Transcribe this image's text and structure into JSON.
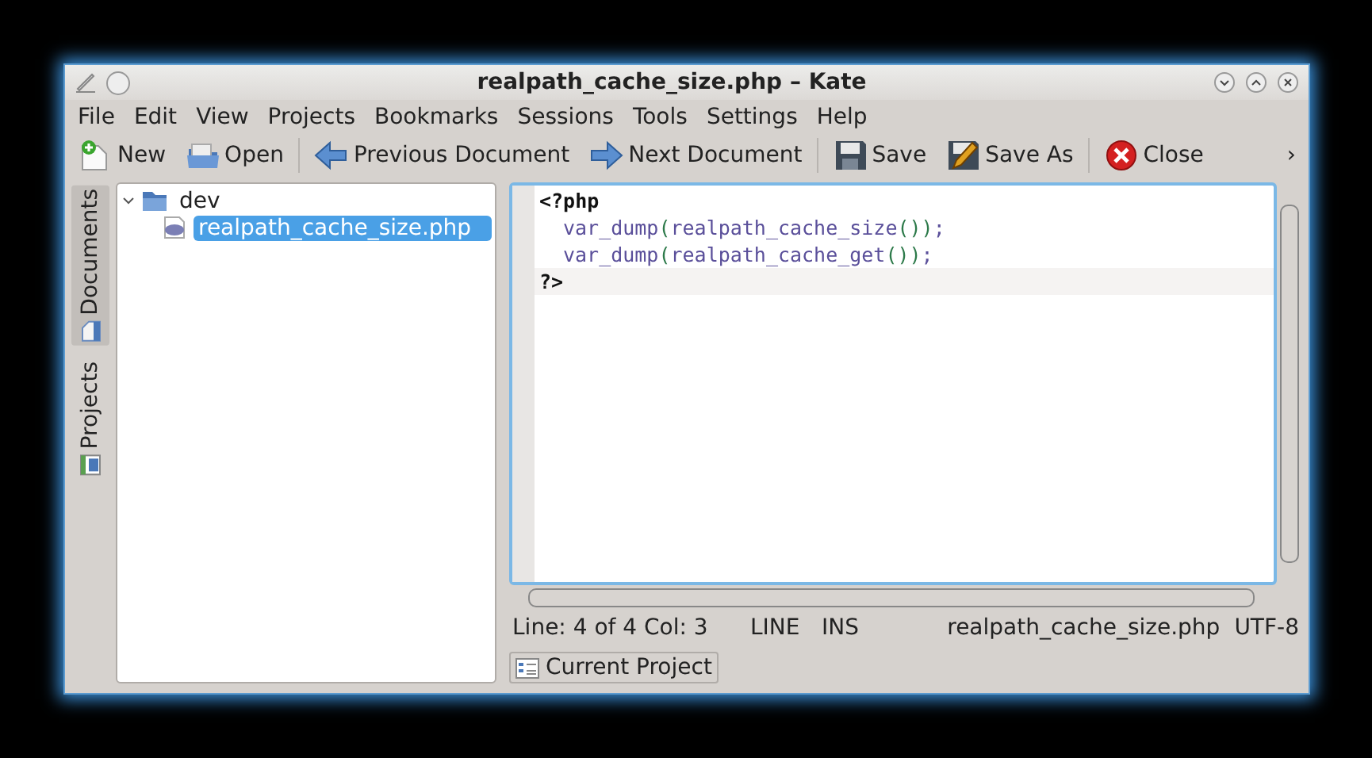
{
  "window": {
    "title": "realpath_cache_size.php – Kate"
  },
  "menu": [
    "File",
    "Edit",
    "View",
    "Projects",
    "Bookmarks",
    "Sessions",
    "Tools",
    "Settings",
    "Help"
  ],
  "toolbar": [
    {
      "kind": "new",
      "label": "New"
    },
    {
      "kind": "open",
      "label": "Open"
    },
    {
      "kind": "sep"
    },
    {
      "kind": "prev",
      "label": "Previous Document"
    },
    {
      "kind": "next",
      "label": "Next Document"
    },
    {
      "kind": "sep"
    },
    {
      "kind": "save",
      "label": "Save"
    },
    {
      "kind": "saveas",
      "label": "Save As"
    },
    {
      "kind": "sep"
    },
    {
      "kind": "close",
      "label": "Close"
    }
  ],
  "overflow": "›",
  "side_tabs": [
    {
      "label": "Documents",
      "selected": true
    },
    {
      "label": "Projects",
      "selected": false
    }
  ],
  "tree": [
    {
      "label": "dev",
      "expanded": true,
      "selected": false,
      "children": [
        {
          "label": "realpath_cache_size.php",
          "selected": true
        }
      ]
    }
  ],
  "editor": {
    "lines": [
      {
        "current": false,
        "indent": false,
        "tokens": [
          {
            "kind": "keyword",
            "text": "<?php"
          }
        ]
      },
      {
        "current": false,
        "indent": true,
        "tokens": [
          {
            "kind": "func",
            "text": "var_dump"
          },
          {
            "kind": "paren",
            "text": "("
          },
          {
            "kind": "func",
            "text": "realpath_cache_size"
          },
          {
            "kind": "paren",
            "text": "())"
          },
          {
            "kind": "func",
            "text": ";"
          }
        ]
      },
      {
        "current": false,
        "indent": true,
        "tokens": [
          {
            "kind": "func",
            "text": "var_dump"
          },
          {
            "kind": "paren",
            "text": "("
          },
          {
            "kind": "func",
            "text": "realpath_cache_get"
          },
          {
            "kind": "paren",
            "text": "())"
          },
          {
            "kind": "func",
            "text": ";"
          }
        ]
      },
      {
        "current": true,
        "indent": false,
        "tokens": [
          {
            "kind": "keyword",
            "text": "?>"
          }
        ]
      }
    ]
  },
  "status_bar": {
    "position": "Line: 4 of 4 Col: 3",
    "mode": "LINE",
    "insert": "INS",
    "file": "realpath_cache_size.php",
    "encoding": "UTF-8"
  },
  "bottom_tabs": [
    {
      "label": "Current Project",
      "selected": false
    }
  ]
}
